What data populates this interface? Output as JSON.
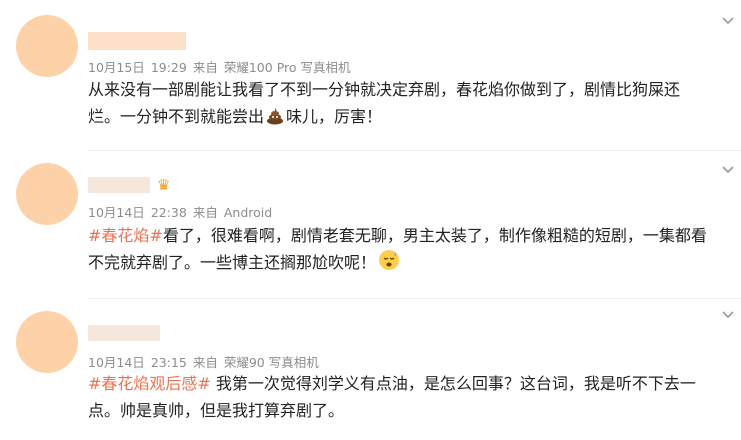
{
  "comments": [
    {
      "date": "10月15日",
      "time": "19:29",
      "from": "来自",
      "device": "荣耀100 Pro 写真相机",
      "line1": "从来没有一部剧能让我看了不到一分钟就决定弃剧，春花焰你做到了，剧情比狗屎还",
      "line2_before": "烂。一分钟不到就能尝出",
      "line2_after": "味儿，厉害！"
    },
    {
      "date": "10月14日",
      "time": "22:38",
      "from": "来自",
      "device": "Android",
      "tag": "#春花焰#",
      "line1": "看了，很难看啊，剧情老套无聊，男主太装了，制作像粗糙的短剧，一集都看",
      "line2": "不完就弃剧了。一些博主还搁那尬吹呢！"
    },
    {
      "date": "10月14日",
      "time": "23:15",
      "from": "来自",
      "device": "荣耀90 写真相机",
      "tag": "#春花焰观后感#",
      "line1": " 我第一次觉得刘学义有点油，是怎么回事？这台词，我是听不下去一",
      "line2": "点。帅是真帅，但是我打算弃剧了。"
    }
  ]
}
